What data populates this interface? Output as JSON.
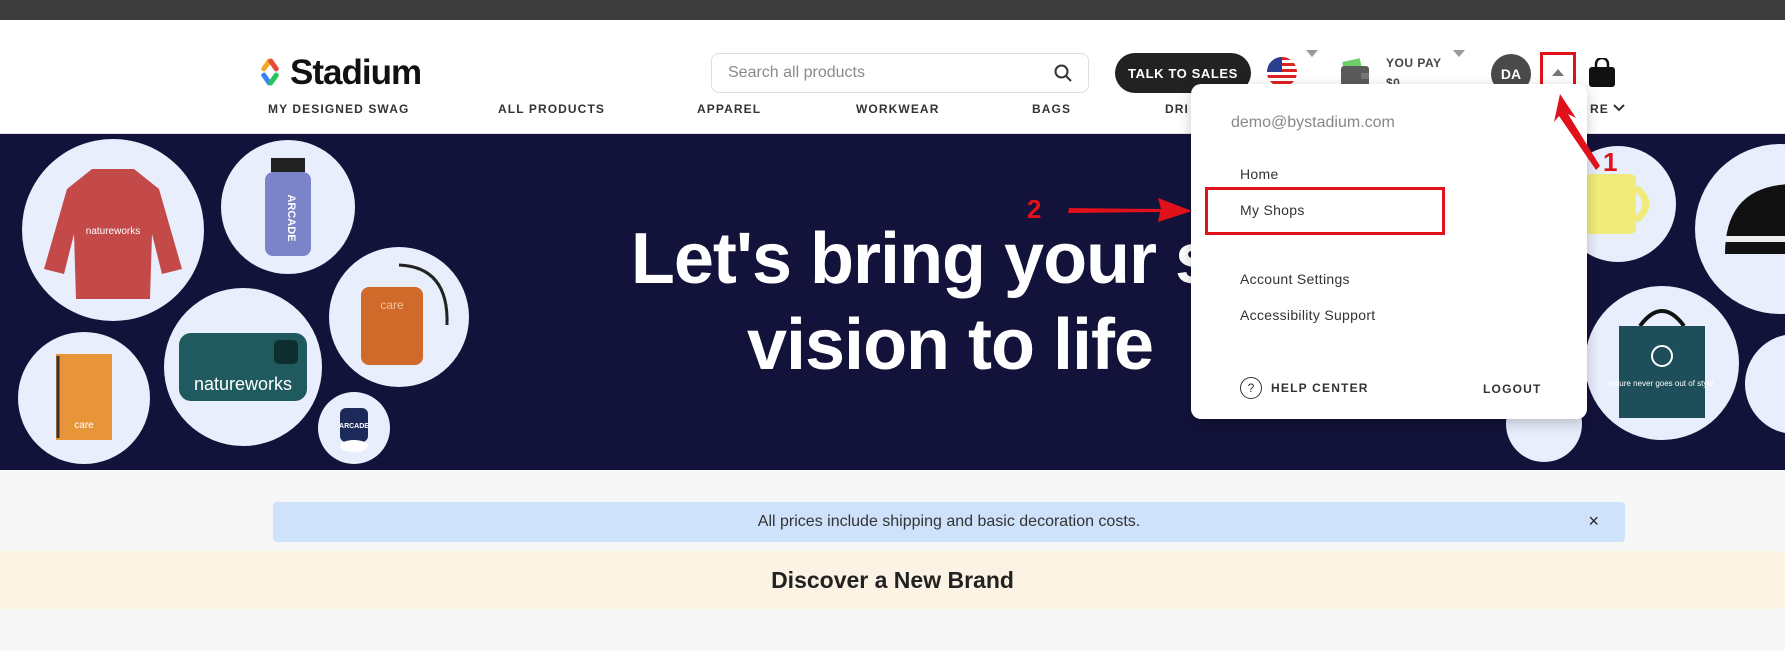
{
  "brand": {
    "name": "Stadium"
  },
  "search": {
    "placeholder": "Search all products"
  },
  "header": {
    "talk_to_sales": "TALK TO SALES",
    "you_pay_label": "YOU PAY",
    "you_pay_value": "$0",
    "avatar_initials": "DA"
  },
  "nav": {
    "items": [
      "MY DESIGNED SWAG",
      "ALL PRODUCTS",
      "APPAREL",
      "WORKWEAR",
      "BAGS",
      "DRI",
      "RE"
    ]
  },
  "hero": {
    "title_line1": "Let's bring your sw",
    "title_line2": "vision to life",
    "bubble_texts": [
      "natureworks",
      "ARCADE",
      "care",
      "natureworks",
      "care",
      "ARCADE",
      "nature never goes out of style."
    ]
  },
  "dropdown": {
    "email": "demo@bystadium.com",
    "items": [
      "Home",
      "My Shops",
      "Account Settings",
      "Accessibility Support"
    ],
    "help_center": "HELP CENTER",
    "help_icon": "?",
    "logout": "LOGOUT"
  },
  "banner": {
    "text": "All prices include shipping and basic decoration costs.",
    "close": "×"
  },
  "discover": {
    "title": "Discover a New Brand"
  },
  "annotations": {
    "step1": "1",
    "step2": "2",
    "color": "#e0111a"
  }
}
